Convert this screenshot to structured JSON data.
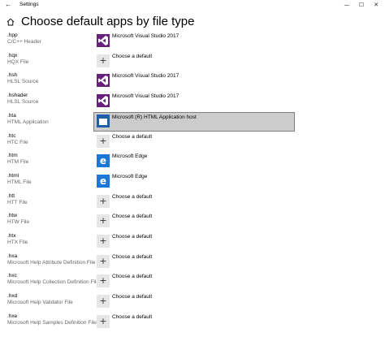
{
  "window": {
    "title": "Settings",
    "back_glyph": "←",
    "minimize_glyph": "—",
    "maximize_glyph": "☐",
    "close_glyph": "✕"
  },
  "page": {
    "title": "Choose default apps by file type"
  },
  "colors": {
    "vs_purple": "#68217a",
    "edge_blue": "#1b78d6",
    "selected_bg": "#cccccc",
    "plus_tile": "#e6e6e6"
  },
  "rows": [
    {
      "ext": ".hpp",
      "desc": "C/C++ Header",
      "app": "Microsoft Visual Studio 2017",
      "icon": "visual-studio-icon"
    },
    {
      "ext": ".hqx",
      "desc": "HQX File",
      "app": "Choose a default",
      "icon": "plus-icon"
    },
    {
      "ext": ".hsh",
      "desc": "HLSL Source",
      "app": "Microsoft Visual Studio 2017",
      "icon": "visual-studio-icon"
    },
    {
      "ext": ".hshader",
      "desc": "HLSL Source",
      "app": "Microsoft Visual Studio 2017",
      "icon": "visual-studio-icon"
    },
    {
      "ext": ".hta",
      "desc": "HTML Application",
      "app": "Microsoft (R) HTML Application host",
      "icon": "html-application-icon",
      "selected": true
    },
    {
      "ext": ".htc",
      "desc": "HTC File",
      "app": "Choose a default",
      "icon": "plus-icon"
    },
    {
      "ext": ".htm",
      "desc": "HTM File",
      "app": "Microsoft Edge",
      "icon": "edge-icon"
    },
    {
      "ext": ".html",
      "desc": "HTML File",
      "app": "Microsoft Edge",
      "icon": "edge-icon"
    },
    {
      "ext": ".htt",
      "desc": "HTT File",
      "app": "Choose a default",
      "icon": "plus-icon"
    },
    {
      "ext": ".htw",
      "desc": "HTW File",
      "app": "Choose a default",
      "icon": "plus-icon"
    },
    {
      "ext": ".htx",
      "desc": "HTX File",
      "app": "Choose a default",
      "icon": "plus-icon"
    },
    {
      "ext": ".hxa",
      "desc": "Microsoft Help Attribute Definition File",
      "app": "Choose a default",
      "icon": "plus-icon"
    },
    {
      "ext": ".hxc",
      "desc": "Microsoft Help Collection Definition File",
      "app": "Choose a default",
      "icon": "plus-icon"
    },
    {
      "ext": ".hxd",
      "desc": "Microsoft Help Validator File",
      "app": "Choose a default",
      "icon": "plus-icon"
    },
    {
      "ext": ".hxe",
      "desc": "Microsoft Help Samples Definition File",
      "app": "Choose a default",
      "icon": "plus-icon"
    }
  ],
  "icons": {
    "plus_glyph": "+",
    "edge_glyph": "e"
  }
}
